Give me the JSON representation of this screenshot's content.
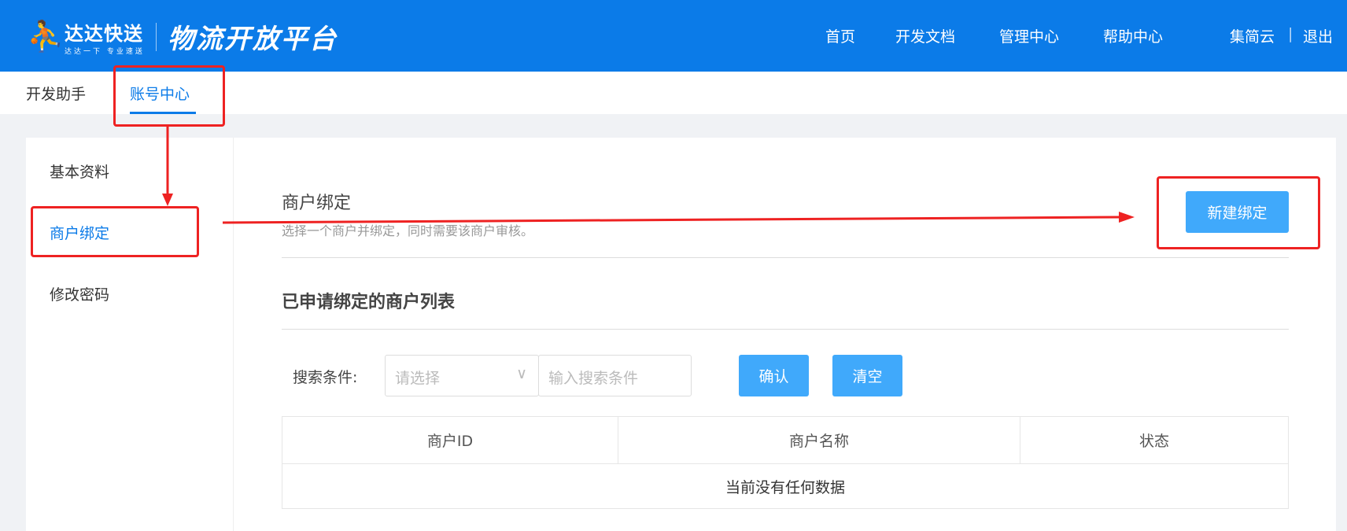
{
  "header": {
    "logo": {
      "brand": "达达快送",
      "slogan": "达达一下 专业速送",
      "platform": "物流开放平台"
    },
    "nav": [
      "首页",
      "开发文档",
      "管理中心",
      "帮助中心"
    ],
    "user": "集简云",
    "divider": "|",
    "logout": "退出",
    "color": "#0b7be8"
  },
  "subnav": {
    "items": [
      "开发助手",
      "账号中心"
    ],
    "active": "账号中心"
  },
  "sidebar": {
    "items": [
      "基本资料",
      "商户绑定",
      "修改密码"
    ],
    "active": "商户绑定"
  },
  "main": {
    "title": "商户绑定",
    "subtitle": "选择一个商户并绑定，同时需要该商户审核。",
    "new_button": "新建绑定",
    "list_title": "已申请绑定的商户列表",
    "search": {
      "label": "搜索条件:",
      "select_placeholder": "请选择",
      "input_placeholder": "输入搜索条件",
      "confirm": "确认",
      "clear": "清空"
    },
    "table": {
      "columns": [
        "商户ID",
        "商户名称",
        "状态"
      ],
      "empty": "当前没有任何数据"
    }
  },
  "annotation_color": "#ee2222"
}
